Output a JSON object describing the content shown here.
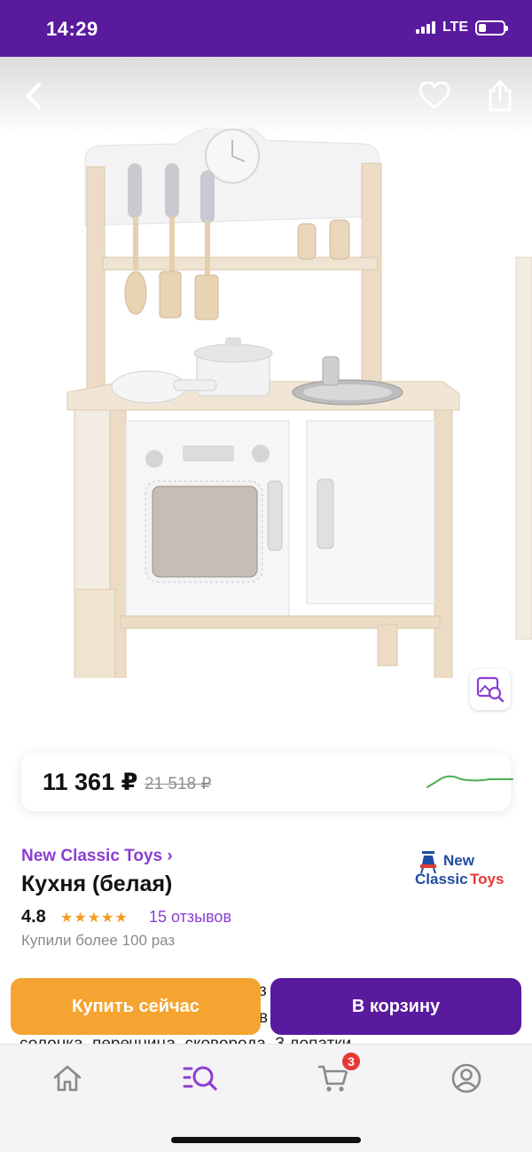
{
  "status_bar": {
    "time": "14:29",
    "network": "LTE",
    "battery_level": 0.3
  },
  "header": {
    "back_icon": "chevron-left-icon",
    "favorite_icon": "heart-icon",
    "share_icon": "share-icon"
  },
  "image": {
    "visual_search_icon": "image-search-icon"
  },
  "price": {
    "current": "11 361 ₽",
    "old": "21 518 ₽",
    "trend_color": "#4caf50"
  },
  "product": {
    "brand": "New Classic Toys ›",
    "brand_logo_line1": "New",
    "brand_logo_line2": "Classic Toys",
    "title": "Кухня (белая)",
    "rating": "4.8",
    "stars": "★★★★★",
    "reviews": "15 отзывов",
    "bought": "Купили более 100 раз"
  },
  "description": {
    "line1": "з",
    "line2": "в",
    "line3": "солонка, перечница, сковорода, 3 лопатки."
  },
  "actions": {
    "buy_now": "Купить сейчас",
    "to_cart": "В корзину"
  },
  "bottom_nav": {
    "items": [
      "home-icon",
      "catalog-search-icon",
      "cart-icon",
      "profile-icon"
    ],
    "cart_badge": "3"
  },
  "colors": {
    "brand_purple": "#5a1a9e",
    "accent_link": "#8b3fd1",
    "buy_orange": "#f5a431",
    "badge_red": "#e53935"
  }
}
